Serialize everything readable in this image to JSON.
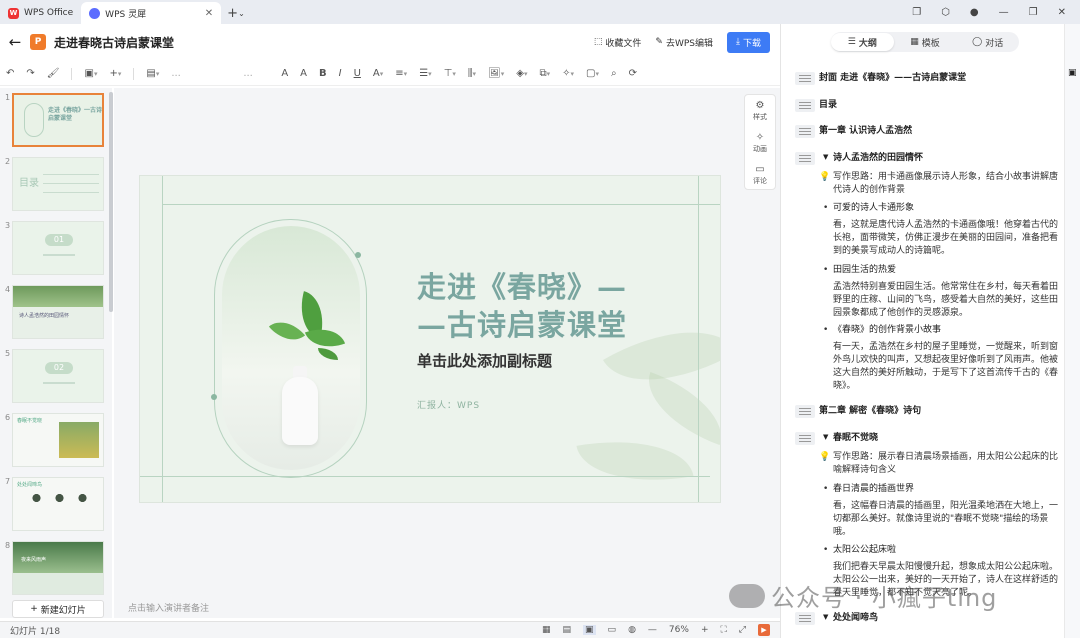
{
  "tabs": [
    {
      "label": "WPS Office",
      "active": false
    },
    {
      "label": "WPS 灵犀",
      "active": true
    }
  ],
  "titlebar": {
    "title": "走进春晓古诗启蒙课堂",
    "favorite": "收藏文件",
    "edit": "去WPS编辑",
    "download": "下载"
  },
  "toolbar": {
    "font_placeholder": "...",
    "size_placeholder": "..."
  },
  "thumbnails": [
    {
      "num": "1",
      "text": "走进《春晓》一古诗启蒙课堂"
    },
    {
      "num": "2",
      "text": "目录"
    },
    {
      "num": "3",
      "text": "01"
    },
    {
      "num": "4",
      "text": "诗人孟浩然的田园情怀"
    },
    {
      "num": "5",
      "text": "02"
    },
    {
      "num": "6",
      "text": "春眠不觉晓"
    },
    {
      "num": "7",
      "text": "处处闻啼鸟"
    },
    {
      "num": "8",
      "text": "夜来风雨声"
    }
  ],
  "new_slide": "新建幻灯片",
  "slide": {
    "title_line1": "走进《春晓》—",
    "title_line2": "—古诗启蒙课堂",
    "subtitle": "单击此处添加副标题",
    "reporter": "汇报人：WPS"
  },
  "side_buttons": {
    "style": "样式",
    "animation": "动画",
    "comment": "评论"
  },
  "notes_placeholder": "点击输入演讲者备注",
  "status": {
    "slide_count": "幻灯片 1/18",
    "zoom": "76%"
  },
  "panel": {
    "tabs": [
      {
        "label": "大纲",
        "active": true
      },
      {
        "label": "模板",
        "active": false
      },
      {
        "label": "对话",
        "active": false
      }
    ],
    "outline": [
      {
        "kind": "h1",
        "text": "封面 走进《春晓》——古诗启蒙课堂"
      },
      {
        "kind": "h1",
        "text": "目录"
      },
      {
        "kind": "h1",
        "text": "第一章 认识诗人孟浩然"
      },
      {
        "kind": "h2",
        "text": "诗人孟浩然的田园情怀"
      },
      {
        "kind": "tip",
        "text": "写作思路：用卡通画像展示诗人形象，结合小故事讲解唐代诗人的创作背景"
      },
      {
        "kind": "bul",
        "text": "可爱的诗人卡通形象"
      },
      {
        "kind": "tx",
        "text": "看，这就是唐代诗人孟浩然的卡通画像哦！他穿着古代的长袍，面带微笑，仿佛正漫步在美丽的田园间，准备把看到的美景写成动人的诗篇呢。"
      },
      {
        "kind": "bul",
        "text": "田园生活的热爱"
      },
      {
        "kind": "tx",
        "text": "孟浩然特别喜爱田园生活。他常常住在乡村，每天看着田野里的庄稼、山间的飞鸟，感受着大自然的美好，这些田园景象都成了他创作的灵感源泉。"
      },
      {
        "kind": "bul",
        "text": "《春晓》的创作背景小故事"
      },
      {
        "kind": "tx",
        "text": "有一天，孟浩然在乡村的屋子里睡觉，一觉醒来，听到窗外鸟儿欢快的叫声，又想起夜里好像听到了风雨声。他被这大自然的美好所触动，于是写下了这首流传千古的《春晓》。"
      },
      {
        "kind": "h1",
        "text": "第二章 解密《春晓》诗句"
      },
      {
        "kind": "h2",
        "text": "春眠不觉晓"
      },
      {
        "kind": "tip",
        "text": "写作思路：展示春日清晨场景插画，用太阳公公起床的比喻解释诗句含义"
      },
      {
        "kind": "bul",
        "text": "春日清晨的插画世界"
      },
      {
        "kind": "tx",
        "text": "看，这幅春日清晨的插画里，阳光温柔地洒在大地上，一切都那么美好。就像诗里说的\"春眠不觉晓\"描绘的场景哦。"
      },
      {
        "kind": "bul",
        "text": "太阳公公起床啦"
      },
      {
        "kind": "tx",
        "text": "我们把春天早晨太阳慢慢升起，想象成太阳公公起床啦。太阳公公一出来，美好的一天开始了，诗人在这样舒适的春天里睡觉，都不知不觉天亮了呢。"
      },
      {
        "kind": "h2",
        "text": "处处闻啼鸟"
      }
    ]
  },
  "watermark": "公众号 · 小瘋子ting",
  "colors": {
    "accent": "#3d7bf5",
    "slide_title": "#7aa6a0",
    "slide_bg": "#ecf3ec",
    "selection": "#e8833a"
  }
}
